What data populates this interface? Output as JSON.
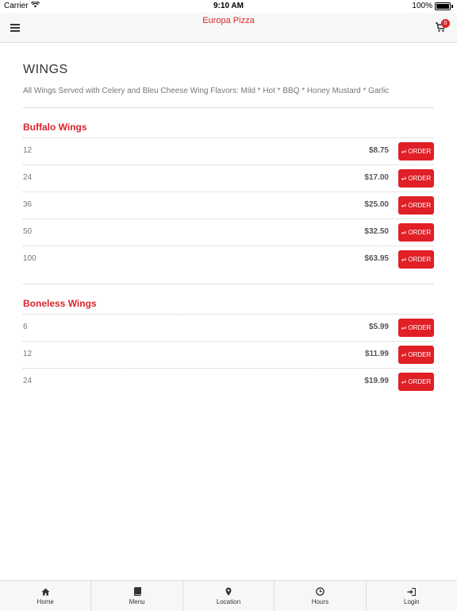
{
  "status": {
    "carrier": "Carrier",
    "time": "9:10 AM",
    "battery": "100%"
  },
  "header": {
    "title": "Europa Pizza",
    "cart_count": "0"
  },
  "section": {
    "title": "WINGS",
    "description": "All Wings Served with Celery and Bleu Cheese Wing Flavors: Mild * Hot * BBQ * Honey Mustard * Garlic"
  },
  "order_label": "ORDER",
  "groups": [
    {
      "name": "Buffalo Wings",
      "items": [
        {
          "qty": "12",
          "price": "$8.75"
        },
        {
          "qty": "24",
          "price": "$17.00"
        },
        {
          "qty": "36",
          "price": "$25.00"
        },
        {
          "qty": "50",
          "price": "$32.50"
        },
        {
          "qty": "100",
          "price": "$63.95"
        }
      ]
    },
    {
      "name": "Boneless Wings",
      "items": [
        {
          "qty": "6",
          "price": "$5.99"
        },
        {
          "qty": "12",
          "price": "$11.99"
        },
        {
          "qty": "24",
          "price": "$19.99"
        }
      ]
    }
  ],
  "tabs": [
    {
      "label": "Home",
      "icon": "home-icon"
    },
    {
      "label": "Menu",
      "icon": "book-icon"
    },
    {
      "label": "Location",
      "icon": "map-pin-icon"
    },
    {
      "label": "Hours",
      "icon": "clock-icon"
    },
    {
      "label": "Login",
      "icon": "login-icon"
    }
  ],
  "colors": {
    "accent": "#e01f26",
    "title_red": "#d9252a"
  }
}
